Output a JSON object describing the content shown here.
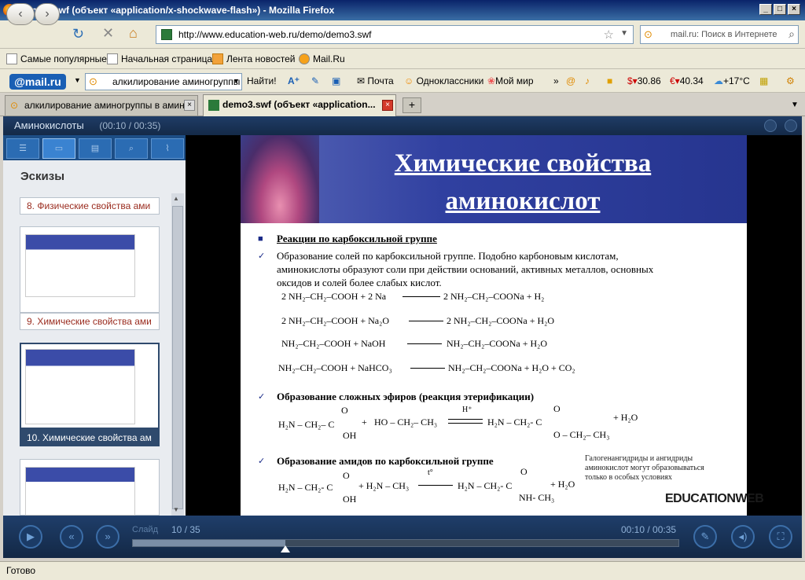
{
  "window": {
    "title": "demo3.swf (объект «application/x-shockwave-flash») - Mozilla Firefox"
  },
  "nav": {
    "url": "http://www.education-web.ru/demo/demo3.swf",
    "search_placeholder": "mail.ru: Поиск в Интернете"
  },
  "bookmarks": [
    "Самые популярные",
    "Начальная страница",
    "Лента новостей",
    "Mail.Ru"
  ],
  "mailbar": {
    "logo": "@mail.ru",
    "search_value": "алкилирование аминогруппы",
    "find_label": "Найти!",
    "mail": "Почта",
    "ok": "Одноклассники",
    "world": "Мой мир",
    "usd": "30.86",
    "eur": "40.34",
    "weather": "+17°C"
  },
  "tabs": [
    {
      "label": "алкилирование аминогруппы в амин..."
    },
    {
      "label": "demo3.swf (объект «application..."
    }
  ],
  "player": {
    "title": "Аминокислоты",
    "time_header": "(00:10 / 00:35)",
    "sidebar_title": "Эскизы",
    "thumbs": [
      "8. Физические свойства ами",
      "9. Химические свойства ами",
      "10. Химические свойства ам"
    ],
    "slide_label": "Слайд",
    "slide_current": "10",
    "slide_total": "/ 35",
    "time_current": "00:10",
    "time_total": "/ 00:35",
    "progress": 0.28
  },
  "slide": {
    "title_line1": "Химические свойства",
    "title_line2": "аминокислот",
    "section1": "Реакции по карбоксильной группе",
    "p1_line1": "Образование солей по карбоксильной группе.  Подобно карбоновым кислотам,",
    "p1_line2": "аминокислоты образуют соли при действии оснований, активных металлов, основных",
    "p1_line3": "оксидов и солей более слабых кислот.",
    "eq1_left": "2 NH₂–CH₂–COOH + 2 Na",
    "eq1_right": "2 NH₂–CH₂–COONa + H₂",
    "eq2_left": "2 NH₂–CH₂–COOH + Na₂O",
    "eq2_right": "2 NH₂–CH₂–COONa + H₂O",
    "eq3_left": "NH₂–CH₂–COOH + NaOH",
    "eq3_right": "NH₂–CH₂–COONa + H₂O",
    "eq4_left": "NH₂–CH₂–COOH + NaHCO₃",
    "eq4_right": "NH₂–CH₂–COONa + H₂O + CO₂",
    "section2": "Образование сложных эфиров (реакция этерификации)",
    "est_left": "H₂N – CH₂– C",
    "est_plus": "+",
    "est_alc": "HO – CH₂– CH₃",
    "est_cat": "H⁺",
    "est_right": "H₂N – CH₂- C",
    "est_r_o": "O – CH₂– CH₃",
    "est_water": "+ H₂O",
    "o_label": "O",
    "oh_label": "OH",
    "section3": "Образование амидов по карбоксильной группе",
    "amid_left": "H₂N – CH₂- C",
    "amid_amine": "+ H₂N – CH₃",
    "amid_cond": "t°",
    "amid_right": "H₂N – CH₂- C",
    "amid_nh": "NH- CH₃",
    "amid_water": "+ H₂O",
    "note_line1": "Галогенангидриды и ангидриды",
    "note_line2": "аминокислот могут образовываться",
    "note_line3": "только в особых условиях",
    "logo": "EDUCATIONWEB"
  },
  "status": {
    "text": "Готово"
  }
}
